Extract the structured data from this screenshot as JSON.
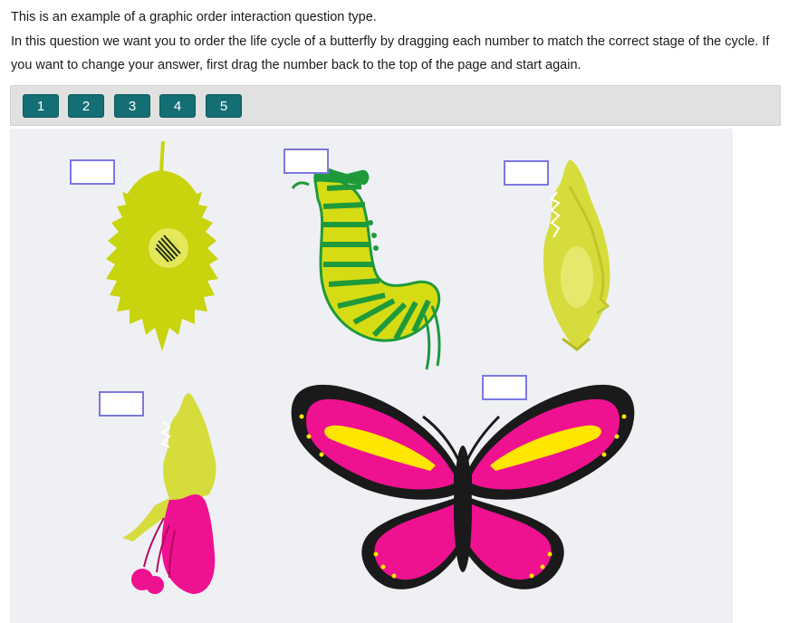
{
  "intro": {
    "line1": "This is an example of a graphic order interaction question type.",
    "line2": "In this question we want you to order the life cycle of a butterfly by dragging each number to match the correct stage of the cycle.  If you want to change your answer, first drag the number back to the top of the page and start again."
  },
  "choices": [
    "1",
    "2",
    "3",
    "4",
    "5"
  ],
  "stages": [
    {
      "name": "egg-on-leaf"
    },
    {
      "name": "caterpillar"
    },
    {
      "name": "chrysalis"
    },
    {
      "name": "emerging-butterfly"
    },
    {
      "name": "adult-butterfly"
    }
  ],
  "colors": {
    "button": "#146f75",
    "drop_border": "#7b78e2",
    "leaf": "#c8d40d",
    "caterpillar_green": "#1f9a3b",
    "butterfly_pink": "#ee1190",
    "butterfly_yellow": "#ffe600",
    "stage_bg": "#eff0f4"
  }
}
